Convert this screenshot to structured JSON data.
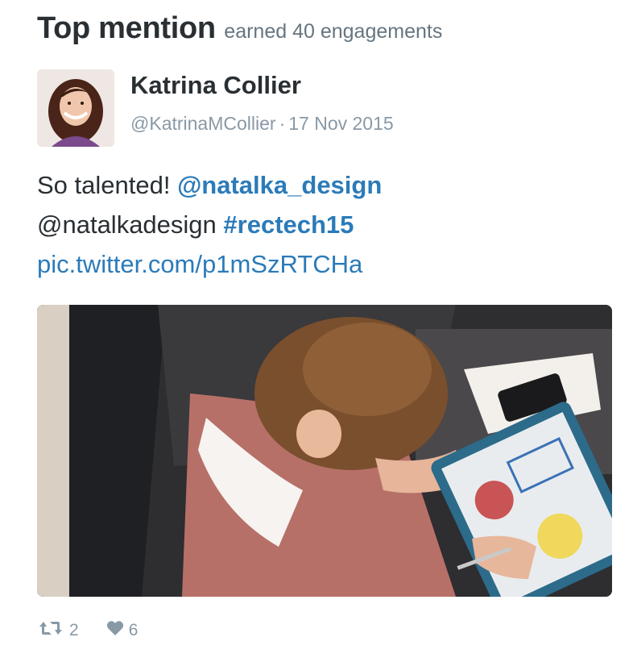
{
  "header": {
    "title": "Top mention",
    "subtitle": "earned 40 engagements"
  },
  "tweet": {
    "author_name": "Katrina Collier",
    "handle": "@KatrinaMCollier",
    "separator": "·",
    "date": "17 Nov 2015",
    "text": {
      "line1_prefix": "So talented! ",
      "mention1": "@natalka_design",
      "line2_prefix": "@natalkadesign ",
      "hashtag": "#rectech15",
      "link": "pic.twitter.com/p1mSzRTCHa"
    },
    "retweets": "2",
    "likes": "6"
  },
  "colors": {
    "link": "#2b7bb9",
    "text": "#292f33",
    "muted": "#8899a6"
  },
  "icons": {
    "retweet": "retweet-icon",
    "like": "heart-icon"
  }
}
